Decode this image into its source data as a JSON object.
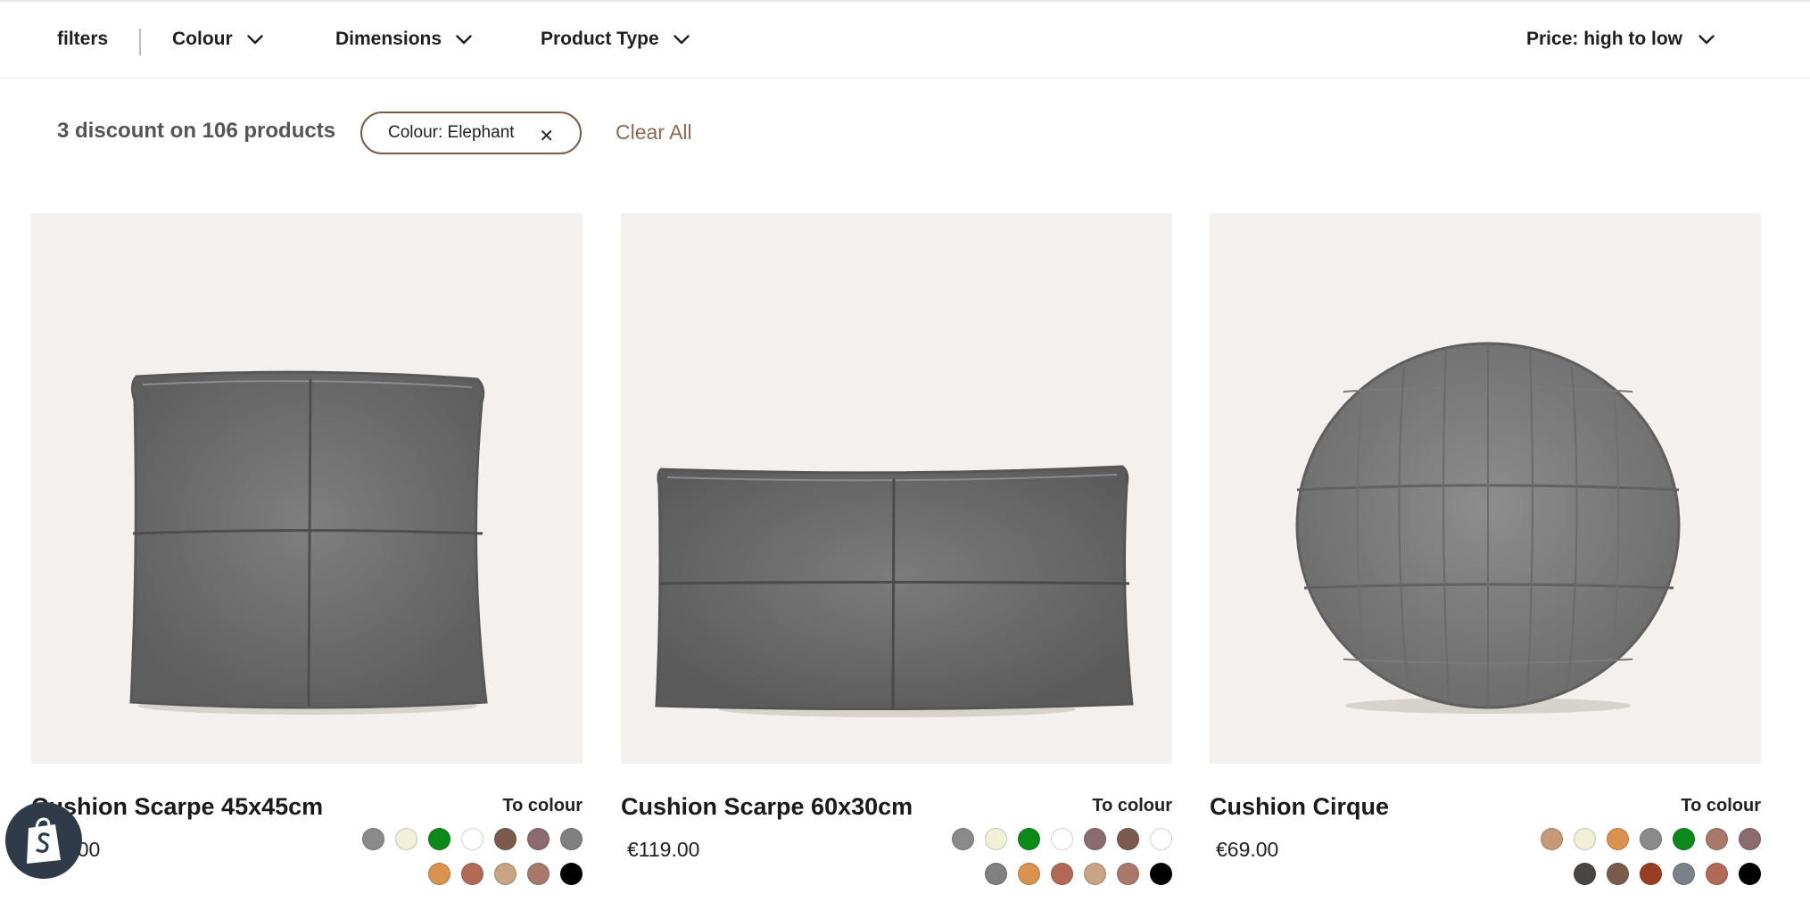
{
  "filterbar": {
    "filters_label": "filters",
    "colour_label": "Colour",
    "dimensions_label": "Dimensions",
    "product_type_label": "Product Type",
    "sort_label": "Price: high to low"
  },
  "results": {
    "summary": "3 discount on 106 products",
    "active_filter": "Colour: Elephant",
    "clear_all": "Clear All"
  },
  "products": [
    {
      "name": "Cushion Scarpe 45x45cm",
      "price": "€89.00",
      "to_colour": "To colour",
      "swatches_row1": [
        "#8a8a8a",
        "#f3f0d8",
        "#0b8a19",
        "#ffffff",
        "#7a5b4d",
        "#8c6b6f",
        "#808080"
      ],
      "swatches_row2": [
        "#d9924f",
        "#b26a57",
        "#c9a484",
        "#a8786a",
        "#000000"
      ]
    },
    {
      "name": "Cushion Scarpe 60x30cm",
      "price": "€119.00",
      "to_colour": "To colour",
      "swatches_row1": [
        "#8a8a8a",
        "#f3f0d8",
        "#0b8a19",
        "#ffffff",
        "#8c6b6f",
        "#7a5b4d",
        "#ffffff"
      ],
      "swatches_row2": [
        "#808080",
        "#d9924f",
        "#b26a57",
        "#c9a484",
        "#a8786a",
        "#000000"
      ]
    },
    {
      "name": "Cushion Cirque",
      "price": "€69.00",
      "to_colour": "To colour",
      "swatches_row1": [
        "#c49a78",
        "#f3f0d8",
        "#d9924f",
        "#8a8a8a",
        "#0b8a19",
        "#a8786a",
        "#8c6b6f"
      ],
      "swatches_row2": [
        "#4a4644",
        "#7a5b4d",
        "#9a3d22",
        "#7b8189",
        "#b26a57",
        "#000000"
      ]
    }
  ],
  "colors": {
    "accent": "#8a6a55",
    "chip_border": "#7a5a45",
    "image_bg": "#f4f0ed"
  },
  "icons": [
    "chevron-down-icon",
    "close-icon",
    "shopify-icon"
  ]
}
